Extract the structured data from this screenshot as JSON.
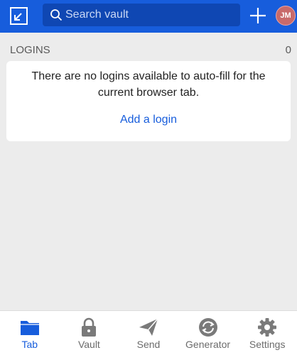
{
  "header": {
    "search_placeholder": "Search vault",
    "avatar_initials": "JM",
    "colors": {
      "bar": "#175ddc",
      "search_bg": "#0f47b3",
      "avatar": "#c86a6a"
    }
  },
  "logins_section": {
    "title": "LOGINS",
    "count": "0"
  },
  "empty_state": {
    "message": "There are no logins available to auto-fill for the current browser tab.",
    "add_link": "Add a login"
  },
  "tabs": [
    {
      "label": "Tab",
      "icon": "folder-icon",
      "active": true
    },
    {
      "label": "Vault",
      "icon": "lock-icon",
      "active": false
    },
    {
      "label": "Send",
      "icon": "send-icon",
      "active": false
    },
    {
      "label": "Generator",
      "icon": "generator-icon",
      "active": false
    },
    {
      "label": "Settings",
      "icon": "gear-icon",
      "active": false
    }
  ]
}
